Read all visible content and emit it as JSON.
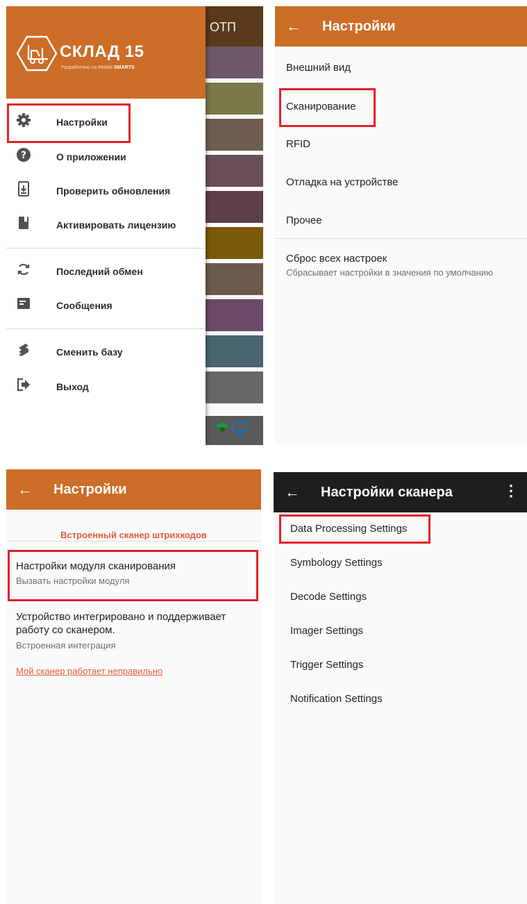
{
  "screen1": {
    "background_header_text": "ОТП",
    "background_strips": [
      "#6e5a6a",
      "#7a7a4a",
      "#6e5e50",
      "#6a4e56",
      "#5e4048",
      "#7a5a08",
      "#6e5a4a",
      "#6a4a66",
      "#4a6472",
      "#666666"
    ],
    "logo": {
      "title": "СКЛАД 15",
      "subtitle_prefix": "Разработано на Mobile",
      "subtitle_brand": "SMARTS"
    },
    "menu": [
      {
        "label": "Настройки",
        "icon": "gear-icon"
      },
      {
        "label": "О приложении",
        "icon": "help-icon"
      },
      {
        "label": "Проверить обновления",
        "icon": "download-icon"
      },
      {
        "label": "Активировать лицензию",
        "icon": "book-icon"
      },
      {
        "label": "Последний обмен",
        "icon": "sync-icon"
      },
      {
        "label": "Сообщения",
        "icon": "message-icon"
      },
      {
        "label": "Сменить базу",
        "icon": "switch-base-icon"
      },
      {
        "label": "Выход",
        "icon": "exit-icon"
      }
    ]
  },
  "screen2": {
    "title": "Настройки",
    "items": [
      "Внешний вид",
      "Сканирование",
      "RFID",
      "Отладка на устройстве",
      "Прочее"
    ],
    "reset": {
      "label": "Сброс всех настроек",
      "description": "Сбрасывает настройки в значения по умолчанию"
    }
  },
  "screen3": {
    "title": "Настройки",
    "section": "Встроенный сканер штрихкодов",
    "module": {
      "label": "Настройки модуля сканирования",
      "description": "Вызвать настройки модуля"
    },
    "integration": {
      "line1": "Устройство интегрировано и поддерживает",
      "line2": "работу со сканером.",
      "description": "Встроенная интеграция"
    },
    "link": "Мой сканер работает неправильно"
  },
  "screen4": {
    "title": "Настройки сканера",
    "items": [
      "Data Processing Settings",
      "Symbology Settings",
      "Decode Settings",
      "Imager Settings",
      "Trigger Settings",
      "Notification Settings"
    ]
  },
  "colors": {
    "accent": "#cc6d28",
    "highlight": "#e3202a",
    "link": "#e55a3a",
    "dark_bar": "#1e1e1e"
  }
}
